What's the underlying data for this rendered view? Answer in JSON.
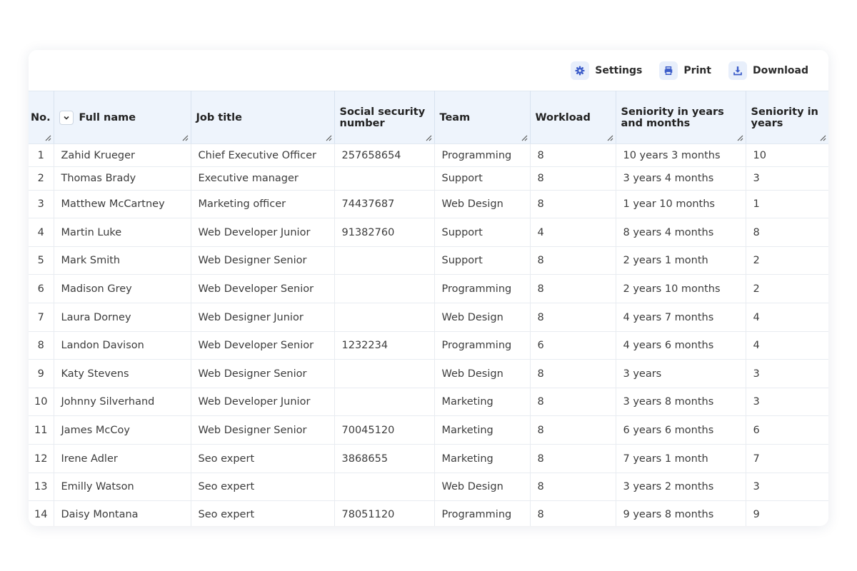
{
  "toolbar": {
    "settings_label": "Settings",
    "print_label": "Print",
    "download_label": "Download",
    "icon_color": "#3b5cc9",
    "icon_bg": "#e8effb"
  },
  "columns": [
    "No.",
    "Full name",
    "Job title",
    "Social security number",
    "Team",
    "Workload",
    "Seniority in years and months",
    "Seniority in years"
  ],
  "rows": [
    [
      "1",
      "Zahid Krueger",
      "Chief Executive Officer",
      "257658654",
      "Programming",
      "8",
      "10 years 3 months",
      "10"
    ],
    [
      "2",
      "Thomas Brady",
      "Executive manager",
      "",
      "Support",
      "8",
      "3 years 4 months",
      "3"
    ],
    [
      "3",
      "Matthew McCartney",
      "Marketing officer",
      "74437687",
      "Web Design",
      "8",
      "1 year 10 months",
      "1"
    ],
    [
      "4",
      "Martin Luke",
      "Web Developer Junior",
      "91382760",
      "Support",
      "4",
      "8 years 4 months",
      "8"
    ],
    [
      "5",
      "Mark Smith",
      "Web Designer Senior",
      "",
      "Support",
      "8",
      "2 years 1 month",
      "2"
    ],
    [
      "6",
      "Madison Grey",
      "Web Developer Senior",
      "",
      "Programming",
      "8",
      "2 years 10 months",
      "2"
    ],
    [
      "7",
      "Laura Dorney",
      "Web Designer Junior",
      "",
      "Web Design",
      "8",
      "4 years 7 months",
      "4"
    ],
    [
      "8",
      "Landon Davison",
      "Web Developer Senior",
      "1232234",
      "Programming",
      "6",
      "4 years 6 months",
      "4"
    ],
    [
      "9",
      "Katy Stevens",
      "Web Designer Senior",
      "",
      "Web Design",
      "8",
      "3 years",
      "3"
    ],
    [
      "10",
      "Johnny Silverhand",
      "Web Developer Junior",
      "",
      "Marketing",
      "8",
      "3 years 8 months",
      "3"
    ],
    [
      "11",
      "James McCoy",
      "Web Designer Senior",
      "70045120",
      "Marketing",
      "8",
      "6 years 6 months",
      "6"
    ],
    [
      "12",
      "Irene Adler",
      "Seo expert",
      "3868655",
      "Marketing",
      "8",
      "7 years 1 month",
      "7"
    ],
    [
      "13",
      "Emilly Watson",
      "Seo expert",
      "",
      "Web Design",
      "8",
      "3 years 2 months",
      "3"
    ],
    [
      "14",
      "Daisy Montana",
      "Seo expert",
      "78051120",
      "Programming",
      "8",
      "9 years 8 months",
      "9"
    ]
  ]
}
